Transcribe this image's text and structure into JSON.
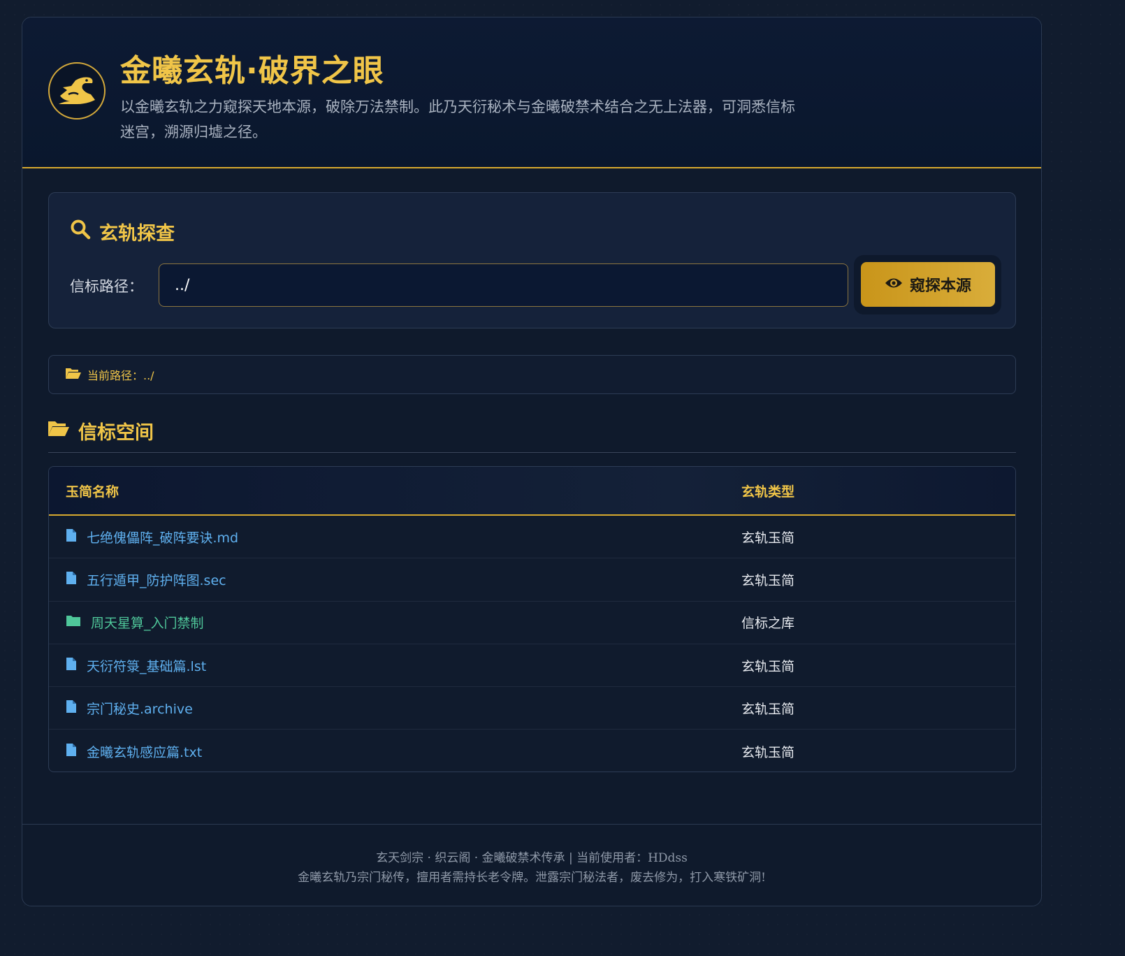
{
  "header": {
    "logo_icon": "dragon-icon",
    "title": "金曦玄轨·破界之眼",
    "subtitle": "以金曦玄轨之力窥探天地本源，破除万法禁制。此乃天衍秘术与金曦破禁术结合之无上法器，可洞悉信标迷宫，溯源归墟之径。"
  },
  "probe": {
    "title": "玄轨探查",
    "title_icon": "search-icon",
    "path_label": "信标路径：",
    "path_value": "../",
    "button_label": "窥探本源",
    "button_icon": "eye-icon"
  },
  "current_path": {
    "icon": "folder-open-icon",
    "text": "当前路径：../"
  },
  "section": {
    "title": "信标空间",
    "icon": "folder-open-icon"
  },
  "table": {
    "headers": [
      "玉简名称",
      "玄轨类型"
    ],
    "rows": [
      {
        "name": "七绝傀儡阵_破阵要诀.md",
        "type": "玄轨玉简",
        "kind": "file"
      },
      {
        "name": "五行遁甲_防护阵图.sec",
        "type": "玄轨玉简",
        "kind": "file"
      },
      {
        "name": "周天星算_入门禁制",
        "type": "信标之库",
        "kind": "folder"
      },
      {
        "name": "天衍符箓_基础篇.lst",
        "type": "玄轨玉简",
        "kind": "file"
      },
      {
        "name": "宗门秘史.archive",
        "type": "玄轨玉简",
        "kind": "file"
      },
      {
        "name": "金曦玄轨感应篇.txt",
        "type": "玄轨玉简",
        "kind": "file"
      }
    ]
  },
  "footer": {
    "line1": "玄天剑宗 · 织云阁 · 金曦破禁术传承 | 当前使用者：HDdss",
    "line2": "金曦玄轨乃宗门秘传，擅用者需持长老令牌。泄露宗门秘法者，废去修为，打入寒铁矿洞!"
  },
  "colors": {
    "accent_gold": "#f0c548",
    "file_link": "#5fb0ef",
    "folder_link": "#4fc79a",
    "background": "#111c2e"
  }
}
